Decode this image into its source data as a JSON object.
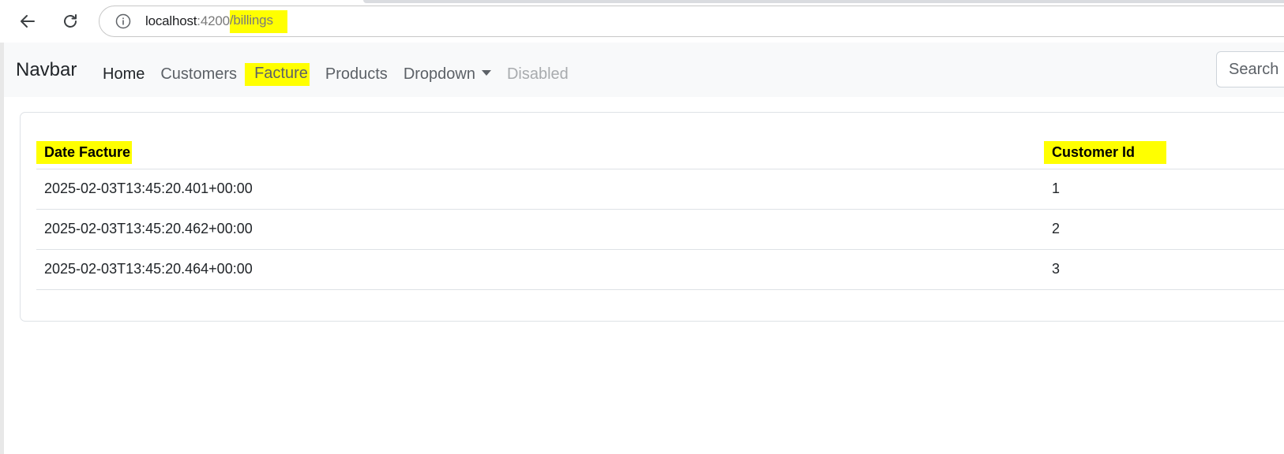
{
  "browser": {
    "url_host": "localhost",
    "url_port": ":4200",
    "url_path": "/billings",
    "icons": {
      "back": "arrow-left-icon",
      "reload": "reload-icon",
      "info": "info-icon"
    }
  },
  "navbar": {
    "brand": "Navbar",
    "links": [
      {
        "label": "Home",
        "state": "active"
      },
      {
        "label": "Customers",
        "state": "normal"
      },
      {
        "label": "Facture",
        "state": "highlighted"
      },
      {
        "label": "Products",
        "state": "normal"
      },
      {
        "label": "Dropdown",
        "state": "dropdown"
      },
      {
        "label": "Disabled",
        "state": "disabled"
      }
    ],
    "search_placeholder": "Search",
    "background": "#f8f9fa"
  },
  "table": {
    "headers": [
      "Date Facture",
      "Customer Id"
    ],
    "rows": [
      [
        "2025-02-03T13:45:20.401+00:00",
        "1"
      ],
      [
        "2025-02-03T13:45:20.462+00:00",
        "2"
      ],
      [
        "2025-02-03T13:45:20.464+00:00",
        "3"
      ]
    ]
  },
  "colors": {
    "highlight": "#ffff00",
    "border": "#dee2e6",
    "muted_text": "#5c6167",
    "disabled_text": "#a8abae"
  }
}
